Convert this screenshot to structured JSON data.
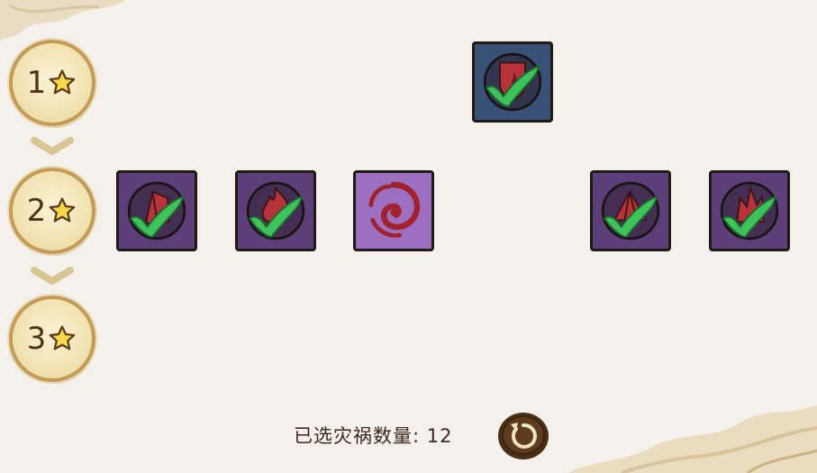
{
  "tiers": [
    {
      "number": "1",
      "star_icon": "star-outline-icon"
    },
    {
      "number": "2",
      "star_icon": "star-outline-icon"
    },
    {
      "number": "3",
      "star_icon": "star-outline-icon"
    }
  ],
  "tiles": [
    {
      "tier": 1,
      "color": "blue",
      "emblem": "flame-emblem-icon",
      "selected": true
    },
    {
      "tier": 2,
      "color": "purple",
      "emblem": "crystal-emblem-icon",
      "selected": true
    },
    {
      "tier": 2,
      "color": "purple",
      "emblem": "fire-emblem-icon",
      "selected": true
    },
    {
      "tier": 2,
      "color": "light-purple",
      "emblem": "vortex-emblem-icon",
      "selected": false
    },
    {
      "tier": 2,
      "color": "purple",
      "emblem": "tent-emblem-icon",
      "selected": true
    },
    {
      "tier": 2,
      "color": "purple",
      "emblem": "crystal-cluster-emblem-icon",
      "selected": true
    }
  ],
  "footer": {
    "selected_count_label": "已选灾祸数量: 12"
  },
  "reset_button": {
    "icon": "refresh-icon"
  },
  "colors": {
    "badge_border": "#c49b57",
    "tile_purple": "#5c3f79",
    "tile_blue": "#3a5177",
    "tile_light_purple": "#9d6fc0",
    "check_green": "#3ec25b",
    "emblem_red": "#b8323a"
  }
}
